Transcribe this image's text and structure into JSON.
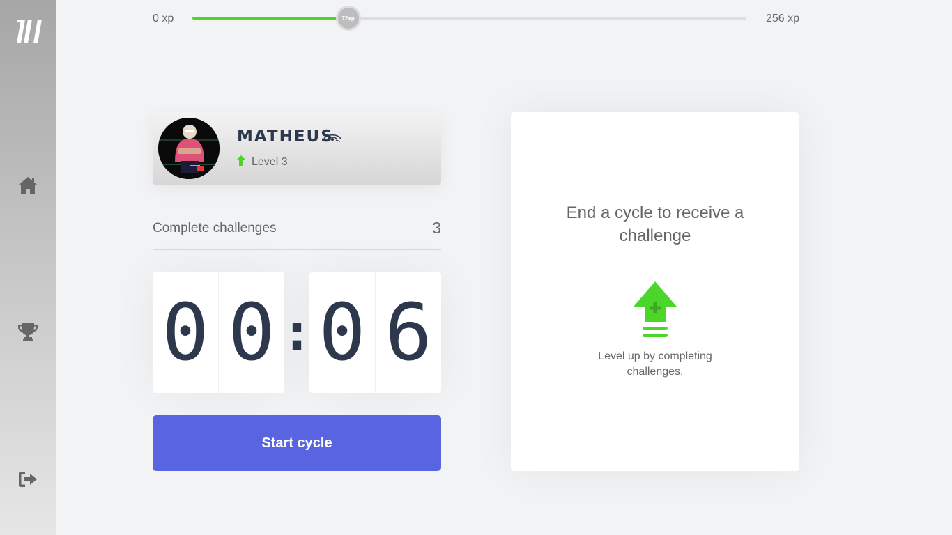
{
  "xp": {
    "min_label": "0 xp",
    "max_label": "256 xp",
    "current_label": "72xp",
    "current": 72,
    "max": 256
  },
  "sidebar": {
    "items": [
      {
        "name": "home",
        "icon": "home-icon"
      },
      {
        "name": "leaderboard",
        "icon": "trophy-icon"
      },
      {
        "name": "logout",
        "icon": "logout-icon"
      }
    ]
  },
  "profile": {
    "name": "MATHEUS",
    "level_label": "Level 3"
  },
  "challenges": {
    "label": "Complete challenges",
    "count": "3"
  },
  "countdown": {
    "minute_left": "0",
    "minute_right": "0",
    "separator": ":",
    "second_left": "0",
    "second_right": "6"
  },
  "actions": {
    "start_label": "Start cycle"
  },
  "challenge_box": {
    "title": "End a cycle to receive a challenge",
    "hint": "Level up by completing challenges."
  },
  "colors": {
    "accent": "#5965e0",
    "green": "#4cd62b",
    "text_dark": "#2e384d",
    "text": "#666666",
    "background": "#f2f3f5"
  }
}
